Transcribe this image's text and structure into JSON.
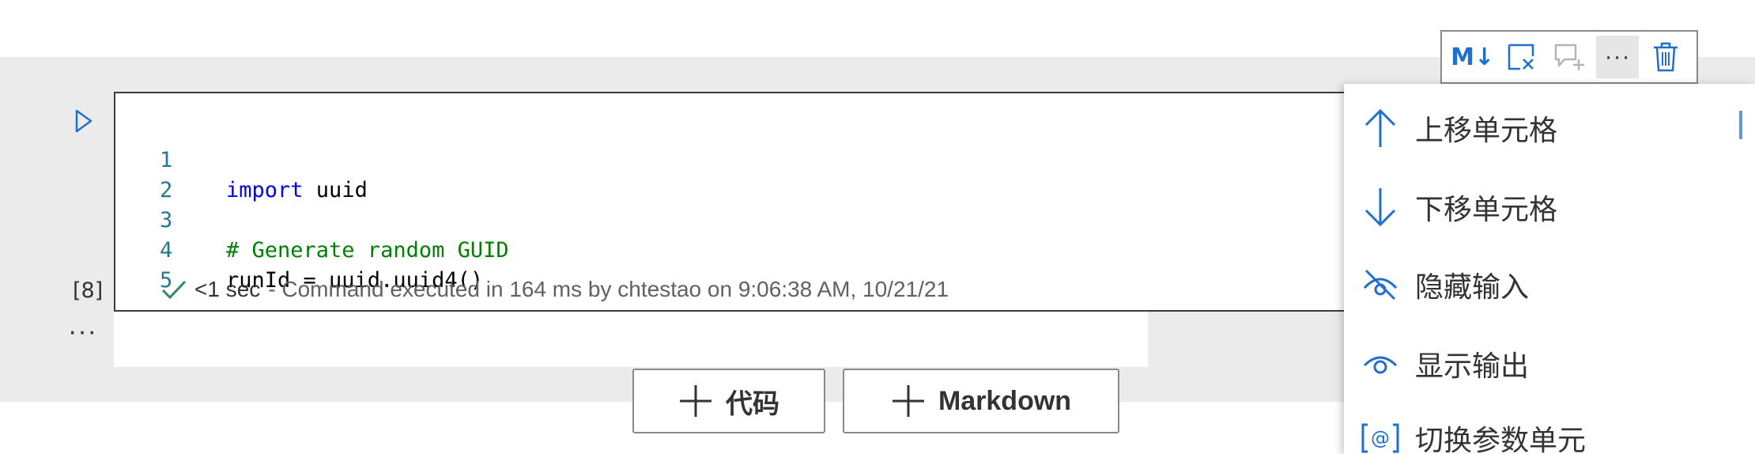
{
  "top_text": "... ... ...",
  "cell": {
    "execution_count": "[8]",
    "more_label": "···",
    "lines": [
      {
        "num": "1",
        "tokens": [
          {
            "t": "import",
            "c": "kw"
          },
          {
            "t": " uuid",
            "c": "id"
          }
        ]
      },
      {
        "num": "2",
        "tokens": []
      },
      {
        "num": "3",
        "tokens": [
          {
            "t": "# Generate random GUID",
            "c": "cm"
          }
        ]
      },
      {
        "num": "4",
        "tokens": [
          {
            "t": "runId = uuid.uuid4()",
            "c": "id"
          }
        ]
      },
      {
        "num": "5",
        "tokens": []
      }
    ],
    "status": {
      "duration": "<1 sec",
      "message": "- Command executed in 164 ms by chtestao on 9:06:38 AM, 10/21/21"
    }
  },
  "add_buttons": {
    "code_label": "代码",
    "markdown_label": "Markdown"
  },
  "toolbar": {
    "markdown_label": "M↓",
    "more_label": "···"
  },
  "context_menu": {
    "items": [
      {
        "label": "上移单元格",
        "icon": "arrow-up-icon"
      },
      {
        "label": "下移单元格",
        "icon": "arrow-down-icon"
      },
      {
        "label": "隐藏输入",
        "icon": "eye-hidden-icon"
      },
      {
        "label": "显示输出",
        "icon": "eye-icon"
      },
      {
        "label": "切换参数单元",
        "icon": "parameter-icon"
      }
    ]
  },
  "colors": {
    "accent": "#1f6fd0",
    "success": "#2e8b57",
    "keyword": "#0000ff",
    "comment": "#008000",
    "line_number": "#237893",
    "band": "#ebebeb"
  }
}
